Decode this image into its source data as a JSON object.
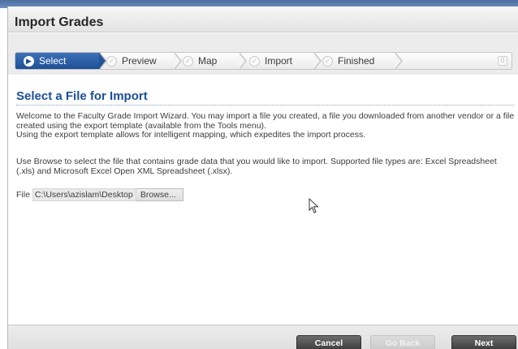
{
  "window": {
    "title": "Import Grades"
  },
  "wizard": {
    "steps": [
      {
        "label": "Select",
        "state": "active"
      },
      {
        "label": "Preview",
        "state": "pending"
      },
      {
        "label": "Map",
        "state": "pending"
      },
      {
        "label": "Import",
        "state": "pending"
      },
      {
        "label": "Finished",
        "state": "pending"
      }
    ],
    "step_count": "0"
  },
  "content": {
    "heading": "Select a File for Import",
    "intro_line1": "Welcome to the Faculty Grade Import Wizard. You may import a file you created, a file you downloaded from another vendor or a file created using the export template (available from the Tools menu).",
    "intro_line2": "Using the export template allows for intelligent mapping, which expedites the import process.",
    "browse_help": "Use Browse to select the file that contains grade data that you would like to import. Supported file types are: Excel Spreadsheet (.xls) and Microsoft Excel Open XML Spreadsheet (.xlsx).",
    "file_label": "File",
    "file_value": "C:\\Users\\azislam\\Desktop",
    "browse_label": "Browse..."
  },
  "footer": {
    "cancel_label": "Cancel",
    "goback_label": "Go Back",
    "next_label": "Next"
  },
  "colors": {
    "accent": "#1b4f9a",
    "active_step": "#2a5ea8",
    "dark_button": "#4a4a4a"
  }
}
